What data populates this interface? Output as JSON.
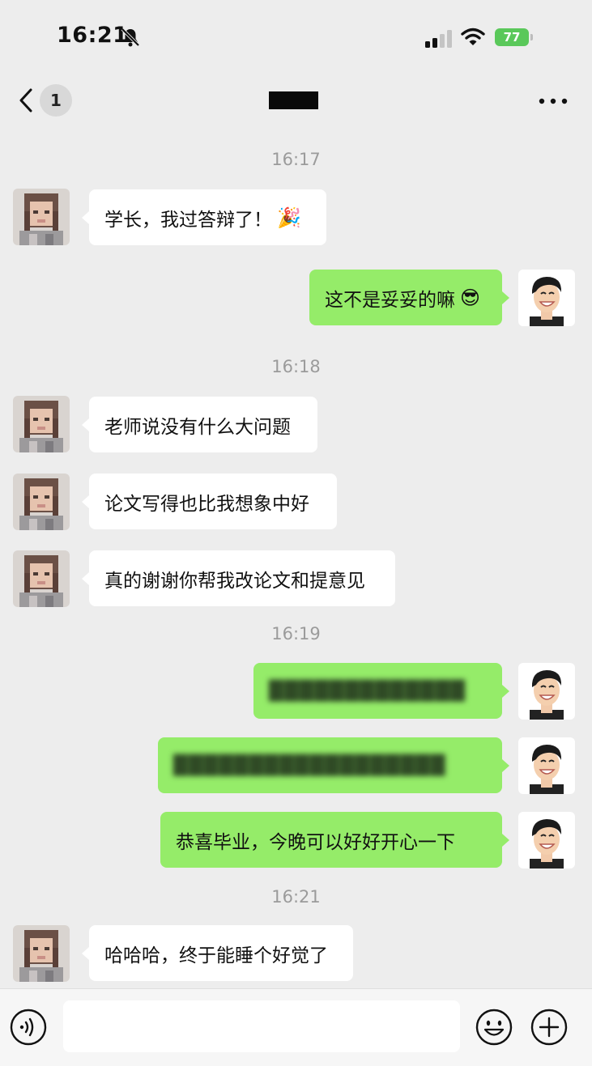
{
  "status": {
    "time": "16:21",
    "battery": "77"
  },
  "header": {
    "unread_count": "1",
    "chat_title": "████"
  },
  "timestamps": [
    "16:17",
    "16:18",
    "16:19",
    "16:21"
  ],
  "messages": [
    {
      "text": "学长，我过答辩了！",
      "emoji": "🎉"
    },
    {
      "text": "这不是妥妥的嘛",
      "emoji": "😎"
    },
    {
      "text": "老师说没有什么大问题"
    },
    {
      "text": "论文写得也比我想象中好"
    },
    {
      "text": "真的谢谢你帮我改论文和提意见"
    },
    {
      "text": "█████████████"
    },
    {
      "text": "██████████████████"
    },
    {
      "text": "恭喜毕业，今晚可以好好开心一下"
    },
    {
      "text": "哈哈哈，终于能睡个好觉了"
    }
  ],
  "input": {
    "value": "",
    "placeholder": ""
  },
  "colors": {
    "background": "#ededed",
    "outgoing_bubble": "#95ec69",
    "incoming_bubble": "#ffffff",
    "battery": "#5ac85a"
  },
  "icons": [
    "bell-slash-icon",
    "signal-icon",
    "wifi-icon",
    "battery-icon",
    "back-chevron-icon",
    "more-icon",
    "voice-icon",
    "emoji-icon",
    "plus-icon"
  ]
}
